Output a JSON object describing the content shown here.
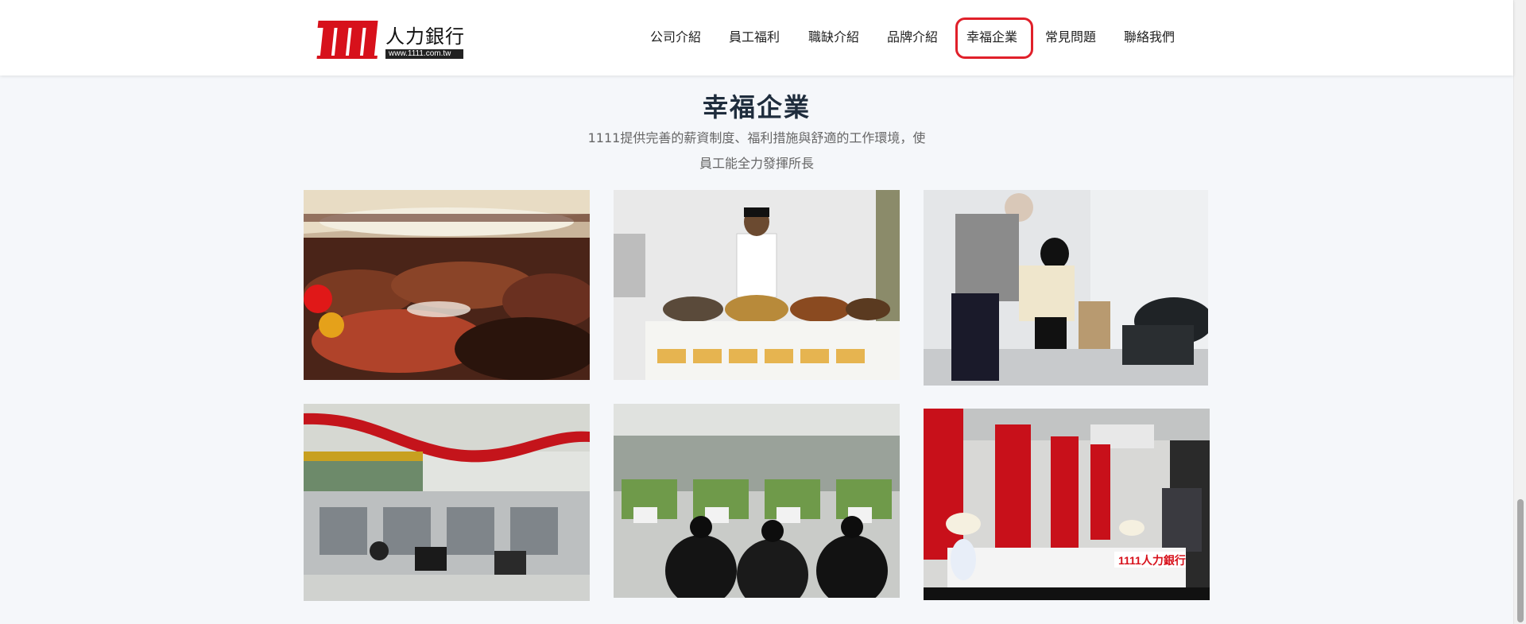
{
  "header": {
    "logo_cn": "人力銀行",
    "logo_url": "www.1111.com.tw",
    "brand_color": "#d7111b",
    "nav": [
      {
        "label": "公司介紹"
      },
      {
        "label": "員工福利"
      },
      {
        "label": "職缺介紹"
      },
      {
        "label": "品牌介紹"
      },
      {
        "label": "幸福企業",
        "active": true
      },
      {
        "label": "常見問題"
      },
      {
        "label": "聯絡我們"
      }
    ],
    "highlight_color": "#e0202a"
  },
  "section": {
    "title": "幸福企業",
    "subtitle_line1": "1111提供完善的薪資制度、福利措施與舒適的工作環境，使",
    "subtitle_line2": "員工能全力發揮所長"
  },
  "gallery": [
    {
      "subject": "year-end-banquet"
    },
    {
      "subject": "chef-buffet"
    },
    {
      "subject": "massage-service"
    },
    {
      "subject": "office-cubicles"
    },
    {
      "subject": "call-center-office"
    },
    {
      "subject": "reception-lobby",
      "sign_text": "1111人力銀行"
    }
  ]
}
